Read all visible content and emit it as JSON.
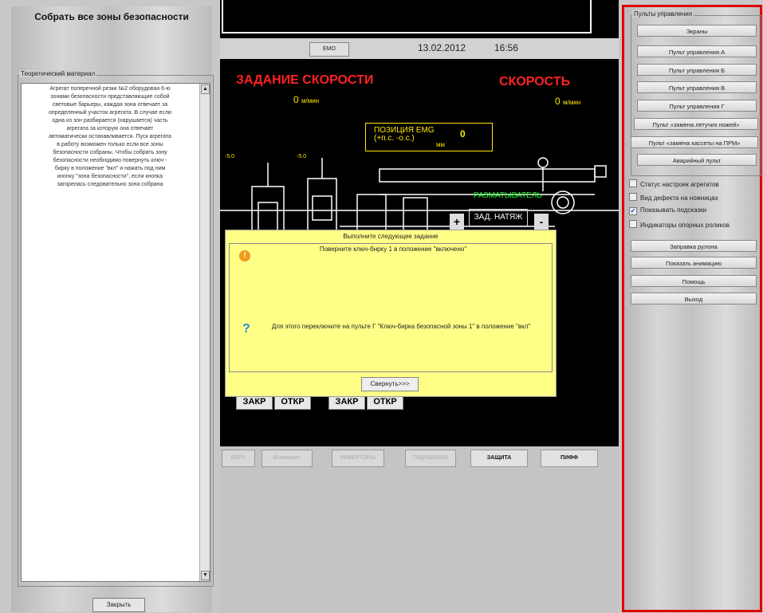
{
  "left": {
    "title": "Собрать все зоны безопасности",
    "theory_label": "Теоретический материал",
    "theory_text": "Агрегат поперечной резки №2 оборудован 6-ю\nзонами безопасности представляющие собой\nсветовые барьеры, каждая зона отвечает за\nопределенный участок агрегата. В случае если\nодна из зон разбирается (нарушается) часть\nагрегата за которую она отвечает\nавтоматически останавливается. Пуск агрегата\nв работу возможен только если все зоны\nбезопасности собраны. Чтобы собрать зону\nбезопасности необходимо повернуть ключ -\nбирку в положение \"вкл\" и нажать под ним\nкнопку \"зона безопасности\", если кнопка\nзагорелась следовательно зона собрана",
    "close_label": "Закрыть"
  },
  "header": {
    "emo_label": "EMO",
    "date": "13.02.2012",
    "time": "16:56"
  },
  "screen": {
    "speed_task_title": "ЗАДАНИЕ СКОРОСТИ",
    "speed_title": "СКОРОСТЬ",
    "speed_task_value": "0",
    "speed_value": "0",
    "speed_unit": "м/мин",
    "position_label": "ПОЗИЦИЯ EMG\n(+п.с. -о.с.)",
    "position_value": "0",
    "position_unit": "мм",
    "unwinder_label": "РАЗМАТЫВАТЕЛЬ",
    "tension_label": "ЗАД. НАТЯЖ",
    "plus": "+",
    "minus": "-",
    "close_btn": "ЗАКР",
    "open_btn": "ОТКР",
    "marks": [
      "-5.0",
      "-5.0"
    ]
  },
  "tabs": [
    {
      "label": "ВЕРХ",
      "active": false
    },
    {
      "label": "Вспомогат.",
      "active": false
    },
    {
      "label": "ИНВЕРТОРЫ",
      "active": false
    },
    {
      "label": "ГИДРАВЛИКА",
      "active": false
    },
    {
      "label": "ЗАЩИТА",
      "active": true
    },
    {
      "label": "ПИФФ",
      "active": true
    }
  ],
  "dialog": {
    "title": "Выполните следующее задание",
    "task": "Поверните ключ-бирку 1 в положение \"включено\"",
    "hint": "Для этого переключите на пульте  Г  \"Ключ-бирка безопасной зоны 1\" в положение \"вкл\"",
    "collapse_label": "Свернуть>>>"
  },
  "right": {
    "group_label": "Пульты управления",
    "pult_buttons": [
      "Экраны",
      "Пульт управления А",
      "Пульт управления Б",
      "Пульт управления В",
      "Пульт управления Г",
      "Пульт «замена летучих ножей»",
      "Пульт «замена кассеты на ПРМ»",
      "Аварийный пульт"
    ],
    "checkboxes": [
      {
        "label": "Статус настроек агрегатов",
        "checked": false
      },
      {
        "label": "Вид дефекта на ножницах",
        "checked": false
      },
      {
        "label": "Показывать подсказки",
        "checked": true
      },
      {
        "label": "Индикаторы опорных роликов",
        "checked": false
      }
    ],
    "actions": [
      "Заправка рулона",
      "Показать анимацию",
      "Помощь",
      "Выход"
    ]
  },
  "colors": {
    "accent_red": "#e00000",
    "dialog_bg": "#ffff88",
    "screen_yellow": "#ffe800",
    "screen_green": "#1cff2a"
  }
}
